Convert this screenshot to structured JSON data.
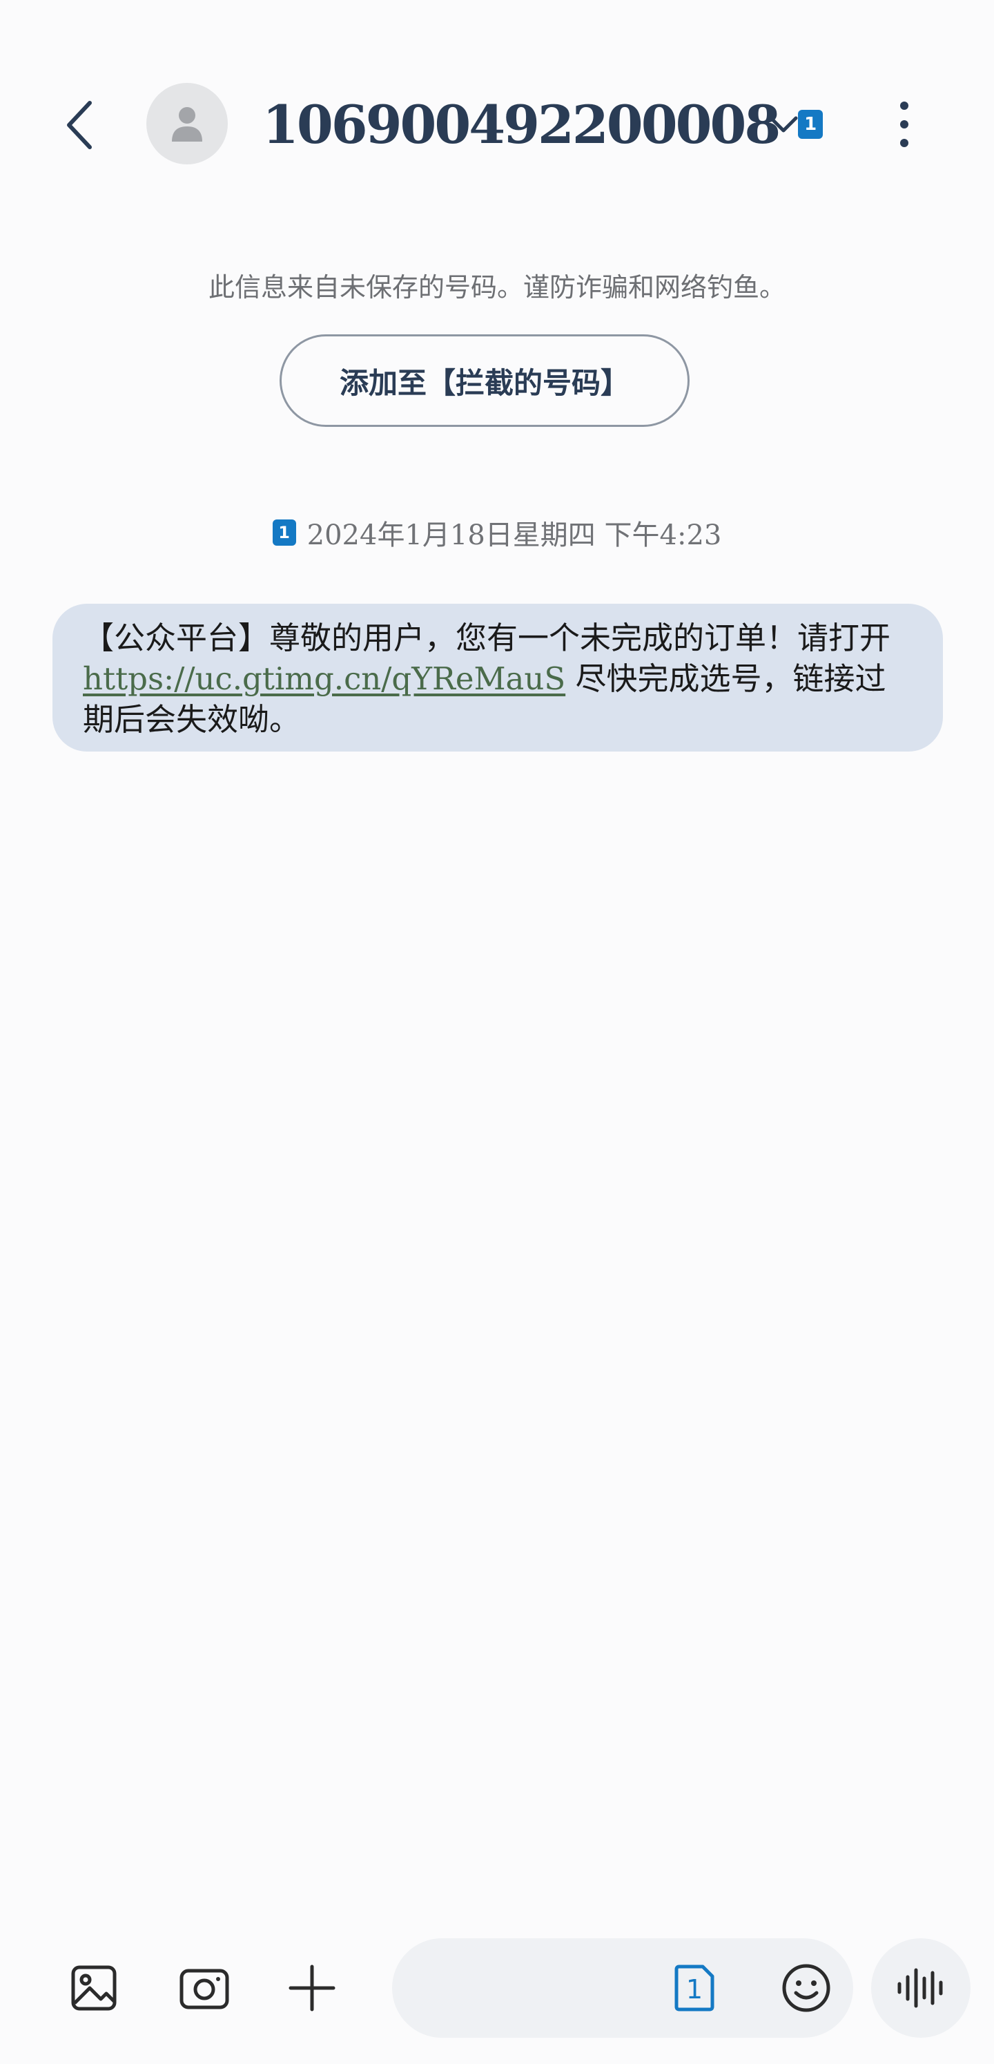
{
  "header": {
    "sender": "106900492200008",
    "sim_label": "1",
    "icons": {
      "back": "chevron-left-icon",
      "avatar": "person-icon",
      "expand": "chevron-down-icon",
      "more": "more-vertical-icon"
    }
  },
  "warning": {
    "text": "此信息来自未保存的号码。谨防诈骗和网络钓鱼。",
    "block_button_label": "添加至【拦截的号码】"
  },
  "conversation": {
    "timestamp": "2024年1月18日星期四 下午4:23",
    "sim_label": "1",
    "message": {
      "text_before_link": "【公众平台】尊敬的用户，您有一个未完成的订单！请打开",
      "link": "https://uc.gtimg.cn/qYReMauS",
      "text_after_link": " 尽快完成选号，链接过期后会失效呦。"
    }
  },
  "composer": {
    "sim_label": "1",
    "icons": {
      "gallery": "image-icon",
      "camera": "camera-icon",
      "add": "plus-icon",
      "sim": "sim-icon",
      "emoji": "emoji-icon",
      "voice": "voice-wave-icon"
    }
  },
  "colors": {
    "title": "#2a3c55",
    "sim_badge": "#1479c4",
    "bubble": "#dae2ee",
    "link": "#4a6b4a",
    "background": "#fbfbfc"
  }
}
